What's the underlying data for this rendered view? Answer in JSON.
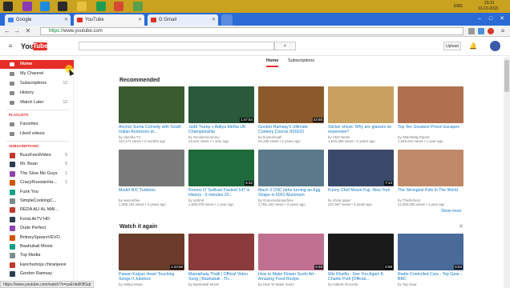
{
  "taskbar": {
    "clock_time": "23:31",
    "clock_date": "13-10-2015",
    "lang": "ENG"
  },
  "browser": {
    "tabs": [
      {
        "label": "Google",
        "favicon_color": "#4285f4"
      },
      {
        "label": "YouTube",
        "favicon_color": "#e52d27"
      },
      {
        "label": "G Gmail",
        "favicon_color": "#d93025"
      }
    ],
    "address_scheme": "https://",
    "address_rest": "www.youtube.com"
  },
  "masthead": {
    "logo_you": "You",
    "logo_tube": "Tube",
    "upload_label": "Upload",
    "search_icon": "magnifier-icon"
  },
  "sidebar": {
    "items": [
      {
        "label": "Home",
        "active": true
      },
      {
        "label": "My Channel"
      },
      {
        "label": "Subscriptions",
        "count": "12"
      },
      {
        "label": "History"
      },
      {
        "label": "Watch Later",
        "count": "12"
      }
    ],
    "playlists_heading": "PLAYLISTS",
    "playlists": [
      {
        "label": "Favorites"
      },
      {
        "label": "Liked videos"
      }
    ],
    "subscriptions_heading": "SUBSCRIPTIONS",
    "subscriptions": [
      {
        "label": "BuzzFeedVideo",
        "count": "5"
      },
      {
        "label": "Mr. Bean",
        "count": "5"
      },
      {
        "label": "The Slow Mo Guys",
        "count": "1"
      },
      {
        "label": "CrazyRussianHa...",
        "count": "1"
      },
      {
        "label": "Funk You"
      },
      {
        "label": "SimpleCookingC..."
      },
      {
        "label": "REDA ALI AL MAI..."
      },
      {
        "label": "KoraLifeTV HD"
      },
      {
        "label": "Dude Perfect"
      },
      {
        "label": "BritneySpearsVEVO"
      },
      {
        "label": "Baahubali Movie"
      },
      {
        "label": "Top Media"
      },
      {
        "label": "kanchumoju chiranjeevi"
      },
      {
        "label": "Gordon Ramsay"
      }
    ]
  },
  "feed": {
    "tabs": [
      "Home",
      "Subscriptions"
    ],
    "recommended_title": "Recommended",
    "watch_again_title": "Watch it again",
    "show_more": "Show more",
    "recommended": [
      {
        "title": "Anchor Suma Comedy with South Indian Actresses at...",
        "channel": "by Vandha TV",
        "meta": "112,171 views • 4 months ago",
        "duration": "",
        "color": "#3a5b2f"
      },
      {
        "title": "Judd Trump v Aditya Mehta UK Championship",
        "channel": "by Snookerscommu",
        "meta": "42,622 views • 1 year ago",
        "duration": "1:47:54",
        "color": "#2a5a3a"
      },
      {
        "title": "Gordon Ramsay's Ultimate Cookery Course S01E01",
        "channel": "by buymeinyah",
        "meta": "62,256 views • 2 years ago",
        "duration": "43:58",
        "color": "#8a5a2a"
      },
      {
        "title": "Sticker shock: Why are glasses so expensive?",
        "channel": "by CBS News",
        "meta": "1,633,355 views • 2 years ago",
        "duration": "",
        "color": "#c8a060"
      },
      {
        "title": "Top Ten Greatest Prison Escapes",
        "channel": "by WatchMojoTop10",
        "meta": "1,845,823 views • 1 year ago",
        "duration": "",
        "color": "#b07050"
      },
      {
        "title": "Model R/C Turbines",
        "channel": "by wascoitfee",
        "meta": "1,089,155 views • 4 years ago",
        "duration": "",
        "color": "#777777"
      },
      {
        "title": "Ronnie O' Sullivan Fastest 147 in History - 5 minutes 20...",
        "channel": "by sortmit",
        "meta": "1,600,978 views • 1 year ago",
        "duration": "5:32",
        "color": "#1f6a3a"
      },
      {
        "title": "Mach 3 CNC lathe turning an Egg Shape in 6061 Aluminum",
        "channel": "by Grassrootsmachine",
        "meta": "1,781,442 views • 3 years ago",
        "duration": "",
        "color": "#5a7a8a"
      },
      {
        "title": "Funny Chef Mount Fuji, New York",
        "channel": "by chiria paper",
        "meta": "227,557 views • 3 years ago",
        "duration": "7:13",
        "color": "#3a4a6a"
      },
      {
        "title": "The Strongest Kids In The World",
        "channel": "by TheRichest",
        "meta": "11,000,000 views • 1 year ago",
        "duration": "",
        "color": "#c08a6a"
      }
    ],
    "watch_again": [
      {
        "title": "Pawan Kalyan Heart Touching Songs II Jukebox",
        "channel": "by Aditya Music",
        "duration": "1:43:58",
        "color": "#6a3a2a"
      },
      {
        "title": "Mamathala Thalli | Official Video Song | Baahubali - Th...",
        "channel": "by Baahubali Movie",
        "duration": "",
        "color": "#8a3a3a"
      },
      {
        "title": "How to Make Flower Sushi Art - Amazing Food Recipe",
        "channel": "by How To Make Sushi",
        "duration": "6:49",
        "color": "#c07090"
      },
      {
        "title": "Wiz Khalifa - See You Again ft. Charlie Puth [Official...",
        "channel": "by Atlantic Records",
        "duration": "3:58",
        "color": "#1a1a1a"
      },
      {
        "title": "Radio Controlled Cars - Top Gear - BBC",
        "channel": "by Top Gear",
        "duration": "5:54",
        "color": "#4a6a9a"
      }
    ]
  },
  "status_bar": "https://www.youtube.com/watch?v=usEnbdKBSqI"
}
